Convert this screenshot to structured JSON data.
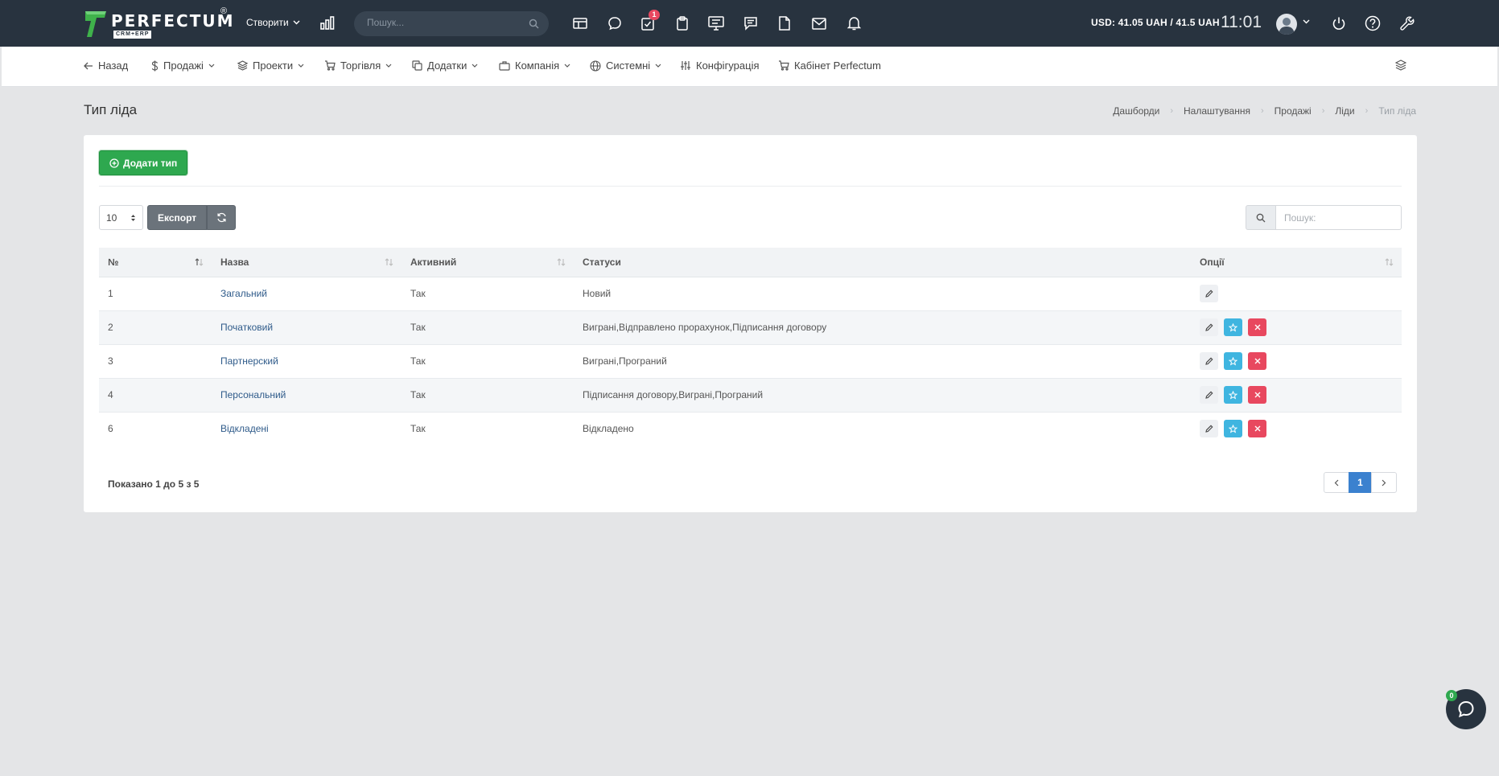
{
  "topbar": {
    "logo_text": "PERFECTUM",
    "logo_registered": "®",
    "logo_sub": "CRM+ERP",
    "create_label": "Створити",
    "search_placeholder": "Пошук...",
    "task_badge": "1",
    "currency": "USD: 41.05 UAH / 41.5 UAH",
    "clock": "11:01",
    "icons": [
      "chart-icon",
      "calendar-icon",
      "chat-icon",
      "tasks-icon",
      "clipboard-icon",
      "monitor-icon",
      "message-icon",
      "document-icon",
      "mail-icon",
      "bell-icon",
      "power-icon",
      "help-icon",
      "wrench-icon"
    ]
  },
  "nav": {
    "back": "Назад",
    "sales": "Продажі",
    "projects": "Проекти",
    "trade": "Торгівля",
    "addons": "Додатки",
    "company": "Компанія",
    "system": "Системні",
    "config": "Конфігурація",
    "cabinet": "Кабінет Perfectum"
  },
  "page": {
    "title": "Тип ліда",
    "breadcrumb": [
      "Дашборди",
      "Налаштування",
      "Продажі",
      "Ліди",
      "Тип ліда"
    ]
  },
  "toolbar": {
    "add_label": "Додати тип",
    "page_length": "10",
    "export_label": "Експорт",
    "search_placeholder": "Пошук:"
  },
  "table": {
    "headers": [
      "№",
      "Назва",
      "Активний",
      "Статуси",
      "Опції"
    ],
    "rows": [
      {
        "id": "1",
        "name": "Загальний",
        "active": "Так",
        "statuses": "Новий",
        "deletable": false
      },
      {
        "id": "2",
        "name": "Початковий",
        "active": "Так",
        "statuses": "Виграні,Відправлено прорахунок,Підписання договору",
        "deletable": true
      },
      {
        "id": "3",
        "name": "Партнерский",
        "active": "Так",
        "statuses": "Виграні,Програний",
        "deletable": true
      },
      {
        "id": "4",
        "name": "Персональний",
        "active": "Так",
        "statuses": "Підписання договору,Виграні,Програний",
        "deletable": true
      },
      {
        "id": "6",
        "name": "Відкладені",
        "active": "Так",
        "statuses": "Відкладено",
        "deletable": true
      }
    ]
  },
  "footer": {
    "info": "Показано 1 до 5 з 5",
    "current_page": "1"
  },
  "chat": {
    "badge": "0"
  },
  "colors": {
    "topbar": "#28333f",
    "accent_green": "#2ea84f",
    "link": "#2f5b8a",
    "pager_active": "#3b81cf",
    "danger": "#e8485f",
    "info": "#3fb5e0"
  }
}
